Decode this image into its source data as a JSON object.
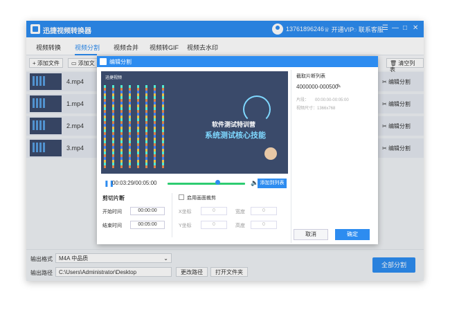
{
  "app": {
    "title": "迅捷视频转换器"
  },
  "user": {
    "phone": "13761896246",
    "vip_label": "开通VIP",
    "service_label": "联系客服"
  },
  "window_buttons": [
    "☰",
    "—",
    "□",
    "✕"
  ],
  "nav": {
    "tabs": [
      "视频转换",
      "视频分割",
      "视频合并",
      "视频转GIF",
      "视频去水印"
    ],
    "active": 1
  },
  "toolbar": {
    "add_file": "+ 添加文件",
    "add_folder": "添加文",
    "clear_list": "清空列表"
  },
  "files": [
    {
      "name": "4.mp4",
      "action": "编辑分割"
    },
    {
      "name": "1.mp4",
      "action": "编辑分割"
    },
    {
      "name": "2.mp4",
      "action": "编辑分割"
    },
    {
      "name": "3.mp4",
      "action": "编辑分割"
    }
  ],
  "bottom": {
    "format_label": "输出格式",
    "format_value": "M4A 中品质",
    "path_label": "输出路径",
    "path_value": "C:\\Users\\Administrator\\Desktop",
    "change_path": "更改路径",
    "open_folder": "打开文件夹",
    "split_all": "全部分割"
  },
  "modal": {
    "title": "编辑分割",
    "video": {
      "logo": "迅捷视频",
      "caption1": "软件测试特训营",
      "caption2": "系统测试核心技能"
    },
    "timecode": "00:03:29/00:05:00",
    "add_to_list": "添加到列表",
    "cut_section": "剪切片断",
    "start_label": "开始时间",
    "start_value": "00:00:00",
    "end_label": "结束时间",
    "end_value": "00:05:00",
    "crop_enable": "启用画面裁剪",
    "crop_x": "X坐标",
    "crop_y": "Y坐标",
    "crop_w": "宽度",
    "crop_h": "高度",
    "crop_zero": "0",
    "list_title": "截取片断列表",
    "clip_name": "4000000-000500",
    "clip_meta1": "片段：　　00:00:00-00:05:00",
    "clip_meta2": "视频尺寸：1366x768",
    "cancel": "取消",
    "ok": "确定"
  }
}
